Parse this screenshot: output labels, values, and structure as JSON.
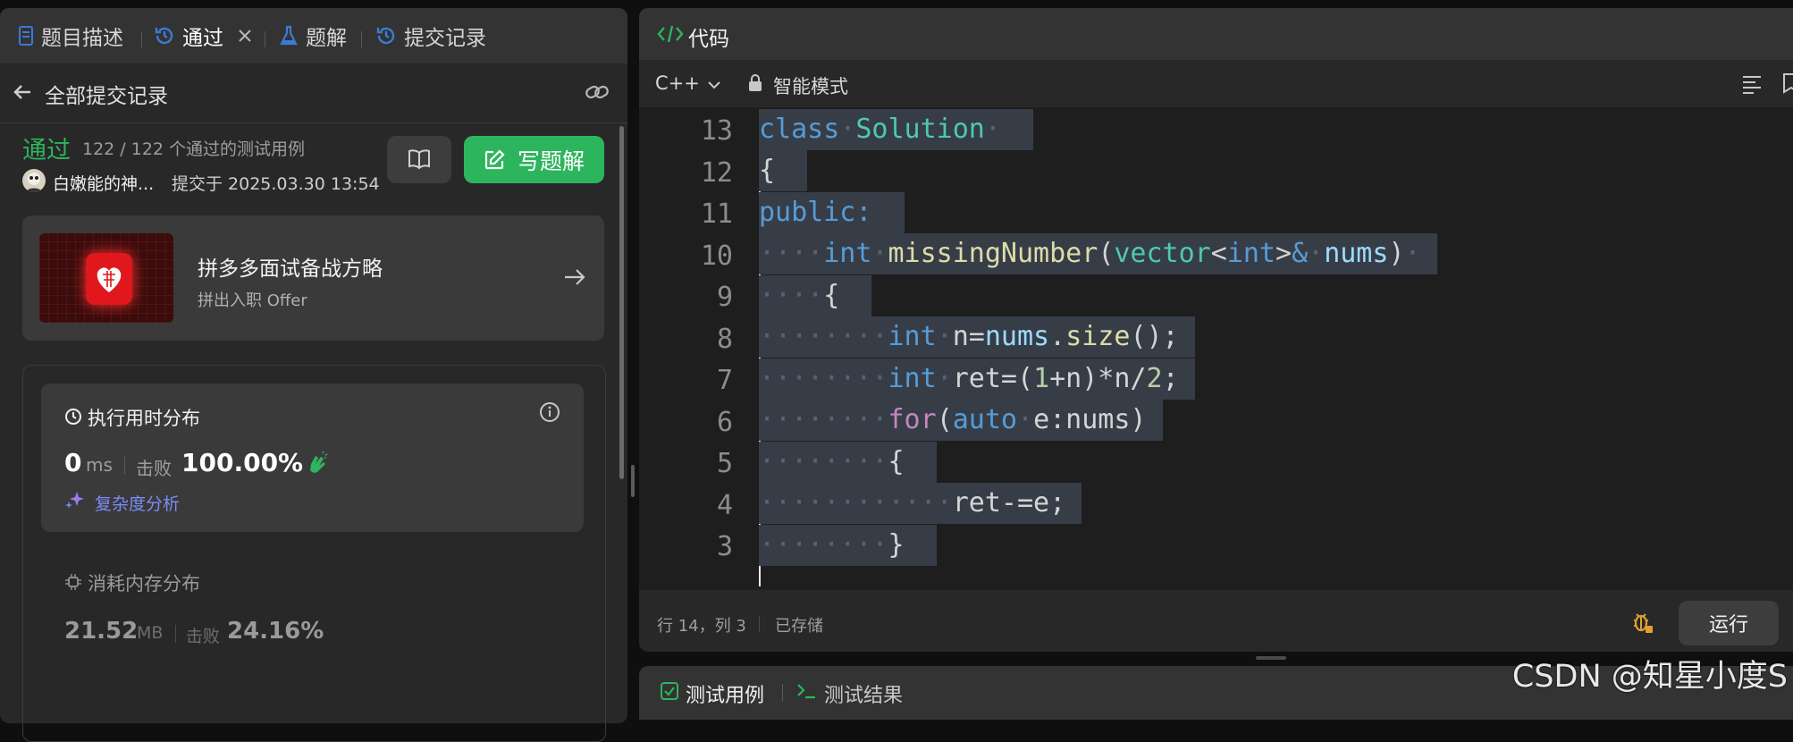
{
  "left_tabs": [
    {
      "label": "题目描述",
      "icon": "document-icon"
    },
    {
      "label": "通过",
      "icon": "history-icon",
      "closable": true
    },
    {
      "label": "题解",
      "icon": "flask-icon"
    },
    {
      "label": "提交记录",
      "icon": "history-icon"
    }
  ],
  "back_row": {
    "label": "全部提交记录"
  },
  "submission": {
    "status": "通过",
    "testcases": "122 / 122 个通过的测试用例",
    "user": "白嫩能的神...",
    "submitted_at": "提交于 2025.03.30 13:54",
    "write_solution": "写题解"
  },
  "promo": {
    "title": "拼多多面试备战方略",
    "subtitle": "拼出入职 Offer"
  },
  "runtime": {
    "title": "执行用时分布",
    "value": "0",
    "unit": "ms",
    "beats_label": "击败",
    "beats": "100.00%",
    "complexity": "复杂度分析"
  },
  "memory": {
    "title": "消耗内存分布",
    "value": "21.52",
    "unit": "MB",
    "beats_label": "击败",
    "beats": "24.16%"
  },
  "code_panel": {
    "title": "代码",
    "language": "C++",
    "mode": "智能模式",
    "status_line": "行 14，列 3",
    "saved": "已存储",
    "run": "运行"
  },
  "line_numbers": [
    "13",
    "12",
    "11",
    "10",
    "9",
    "8",
    "7",
    "6",
    "5",
    "4",
    "3"
  ],
  "bottom_tabs": {
    "testcase": "测试用例",
    "result": "测试结果"
  },
  "watermark": "CSDN @知星小度S",
  "colors": {
    "accent_green": "#2db55d",
    "selection": "#373d47"
  }
}
